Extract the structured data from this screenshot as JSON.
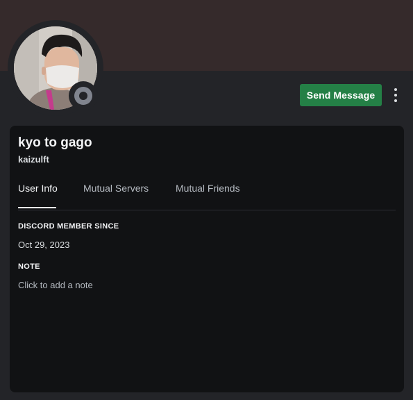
{
  "theme": {
    "banner_color": "#352a2b",
    "background": "#232428",
    "card_background": "#111214",
    "button_color": "#248046",
    "status": "offline"
  },
  "header": {
    "avatar_icon": "user-avatar-photo",
    "status_icon": "offline-status-icon",
    "send_message_label": "Send Message",
    "more_icon": "vertical-ellipsis-icon"
  },
  "profile": {
    "display_name": "kyo to gago",
    "username": "kaizulft"
  },
  "tabs": [
    {
      "label": "User Info",
      "active": true
    },
    {
      "label": "Mutual Servers",
      "active": false
    },
    {
      "label": "Mutual Friends",
      "active": false
    }
  ],
  "info": {
    "member_since_heading": "DISCORD MEMBER SINCE",
    "member_since_value": "Oct 29, 2023",
    "note_heading": "NOTE",
    "note_placeholder": "Click to add a note"
  }
}
